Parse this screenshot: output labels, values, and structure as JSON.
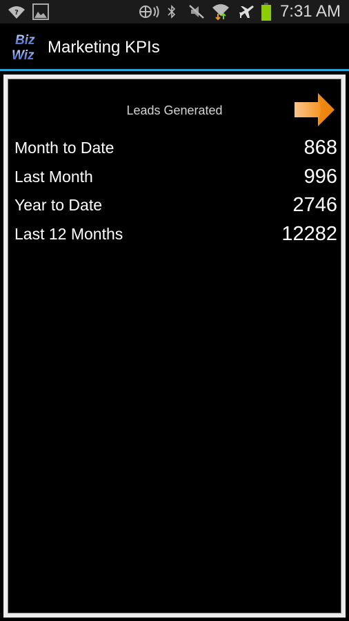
{
  "status_bar": {
    "time": "7:31 AM",
    "icons": [
      "wifi-question-icon",
      "gallery-icon",
      "nfc-icon",
      "bluetooth-icon",
      "mute-icon",
      "wifi-data-icon",
      "airplane-icon",
      "battery-icon"
    ],
    "battery_color": "#8ccc00"
  },
  "action_bar": {
    "logo_text_1": "Biz",
    "logo_text_2": "Wiz",
    "title": "Marketing KPIs",
    "accent_color": "#2aa5d8"
  },
  "card": {
    "title": "Leads Generated",
    "next_icon": "arrow-right-icon",
    "arrow_color": "#f28a10",
    "rows": [
      {
        "label": "Month to Date",
        "value": "868"
      },
      {
        "label": "Last Month",
        "value": "996"
      },
      {
        "label": "Year to Date",
        "value": "2746"
      },
      {
        "label": "Last 12 Months",
        "value": "12282"
      }
    ]
  }
}
